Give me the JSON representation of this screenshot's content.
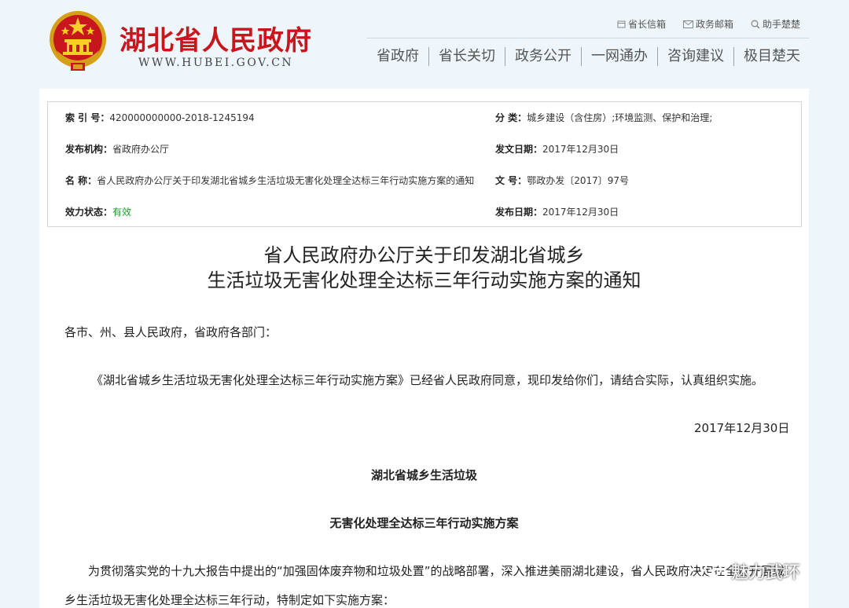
{
  "header": {
    "site_title": "湖北省人民政府",
    "site_url": "WWW.HUBEI.GOV.CN",
    "util_links": [
      {
        "label": "省长信箱",
        "icon": "mail-icon"
      },
      {
        "label": "政务邮箱",
        "icon": "envelope-icon"
      },
      {
        "label": "助手楚楚",
        "icon": "search-icon"
      }
    ],
    "nav": [
      "省政府",
      "省长关切",
      "政务公开",
      "一网通办",
      "咨询建议",
      "极目楚天"
    ]
  },
  "meta": {
    "index_label": "索 引 号：",
    "index_value": "420000000000-2018-1245194",
    "category_label": "分 类：",
    "category_value": "城乡建设（含住房）;环境监测、保护和治理;",
    "publisher_label": "发布机构：",
    "publisher_value": "省政府办公厅",
    "issue_date_label": "发文日期：",
    "issue_date_value": "2017年12月30日",
    "name_label": "名 称：",
    "name_value": "省人民政府办公厅关于印发湖北省城乡生活垃圾无害化处理全达标三年行动实施方案的通知",
    "doc_no_label": "文 号：",
    "doc_no_value": "鄂政办发〔2017〕97号",
    "status_label": "效力状态：",
    "status_value": "有效",
    "publish_date_label": "发布日期：",
    "publish_date_value": "2017年12月30日"
  },
  "document": {
    "title_line1": "省人民政府办公厅关于印发湖北省城乡",
    "title_line2": "生活垃圾无害化处理全达标三年行动实施方案的通知",
    "salutation": "各市、州、县人民政府，省政府各部门：",
    "paragraph1": "《湖北省城乡生活垃圾无害化处理全达标三年行动实施方案》已经省人民政府同意，现印发给你们，请结合实际，认真组织实施。",
    "date": "2017年12月30日",
    "plan_title_line1": "湖北省城乡生活垃圾",
    "plan_title_line2": "无害化处理全达标三年行动实施方案",
    "paragraph2_line1": "为贯彻落实党的十九大报告中提出的“加强固体废弃物和垃圾处置”的战略部署，深入推进美丽湖北建设，省人民政府决定在全省开展城",
    "paragraph2_line2": "乡生活垃圾无害化处理全达标三年行动，特制定如下实施方案："
  },
  "watermark": {
    "text": "魅力武环"
  },
  "colors": {
    "brand_red": "#c8161d",
    "page_bg": "#eef5fb",
    "status_green": "#1a9d2c"
  }
}
